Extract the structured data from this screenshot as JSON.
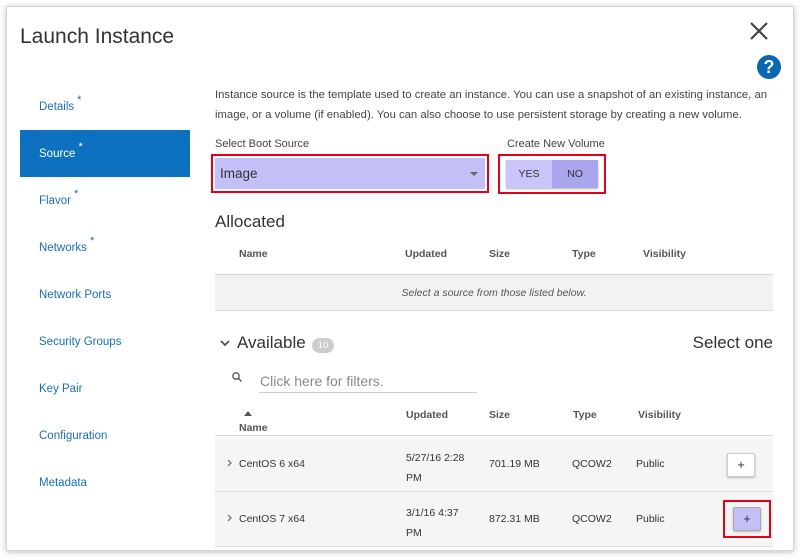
{
  "dialog": {
    "title": "Launch Instance",
    "close_label": "×",
    "help_label": "?"
  },
  "nav": {
    "items": [
      {
        "label": "Details",
        "required": "*"
      },
      {
        "label": "Source",
        "required": "*"
      },
      {
        "label": "Flavor",
        "required": "*"
      },
      {
        "label": "Networks",
        "required": "*"
      },
      {
        "label": "Network Ports",
        "required": ""
      },
      {
        "label": "Security Groups",
        "required": ""
      },
      {
        "label": "Key Pair",
        "required": ""
      },
      {
        "label": "Configuration",
        "required": ""
      },
      {
        "label": "Metadata",
        "required": ""
      }
    ],
    "active": "Source"
  },
  "source": {
    "intro": "Instance source is the template used to create an instance. You can use a snapshot of an existing instance, an image, or a volume (if enabled). You can also choose to use persistent storage by creating a new volume.",
    "boot_source_label": "Select Boot Source",
    "boot_source_value": "Image",
    "create_volume_label": "Create New Volume",
    "yes_label": "YES",
    "no_label": "NO",
    "create_volume_selected": "NO"
  },
  "allocated": {
    "heading": "Allocated",
    "columns": [
      "Name",
      "Updated",
      "Size",
      "Type",
      "Visibility"
    ],
    "empty_message": "Select a source from those listed below."
  },
  "available": {
    "heading": "Available",
    "count": "10",
    "select_hint": "Select one",
    "filter_placeholder": "Click here for filters.",
    "columns": [
      "Name",
      "Updated",
      "Size",
      "Type",
      "Visibility"
    ],
    "sort_column": "Name",
    "sort_direction": "ascending",
    "rows": [
      {
        "name": "CentOS 6 x64",
        "updated_line1": "5/27/16 2:28",
        "updated_line2": "PM",
        "size": "701.19 MB",
        "type": "QCOW2",
        "visibility": "Public",
        "add_label": "+"
      },
      {
        "name": "CentOS 7 x64",
        "updated_line1": "3/1/16 4:37",
        "updated_line2": "PM",
        "size": "872.31 MB",
        "type": "QCOW2",
        "visibility": "Public",
        "add_label": "+"
      }
    ]
  },
  "colors": {
    "nav_active": "#0d71c0",
    "link": "#1a6fb4",
    "highlight_border": "#e4001b",
    "highlight_fill": "#c3bff7"
  }
}
